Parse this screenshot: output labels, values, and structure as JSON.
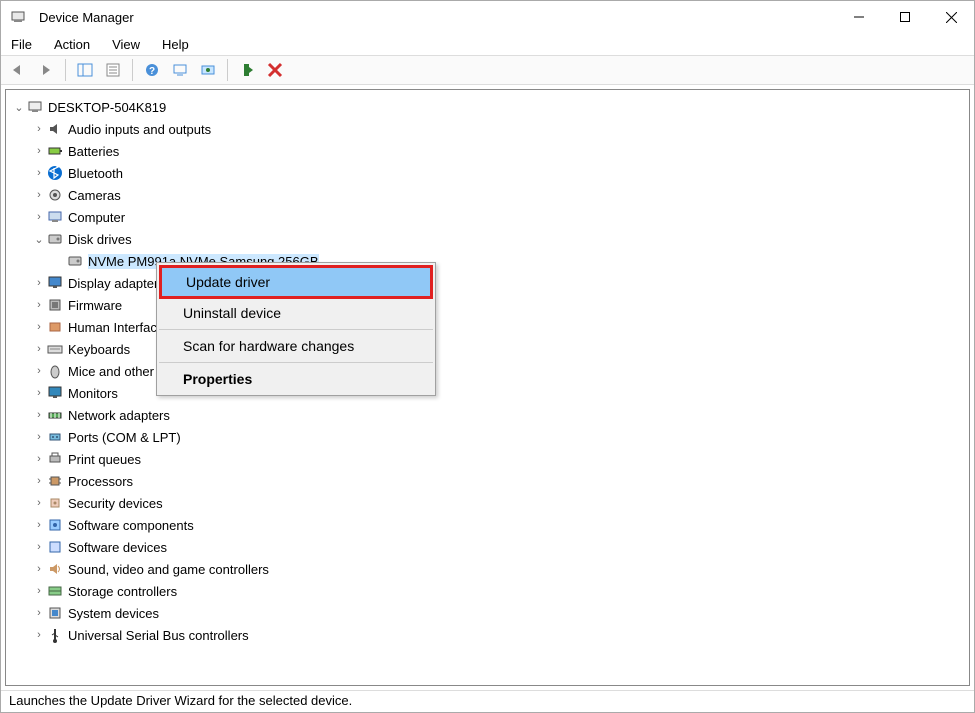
{
  "window": {
    "title": "Device Manager"
  },
  "menu": {
    "file": "File",
    "action": "Action",
    "view": "View",
    "help": "Help"
  },
  "tree": {
    "root": "DESKTOP-504K819",
    "items": [
      {
        "label": "Audio inputs and outputs",
        "icon": "audio"
      },
      {
        "label": "Batteries",
        "icon": "battery"
      },
      {
        "label": "Bluetooth",
        "icon": "bluetooth"
      },
      {
        "label": "Cameras",
        "icon": "camera"
      },
      {
        "label": "Computer",
        "icon": "computer"
      },
      {
        "label": "Disk drives",
        "icon": "disk",
        "expanded": true,
        "children": [
          {
            "label": "NVMe PM991a NVMe Samsung 256GB",
            "icon": "disk",
            "selected": true
          }
        ]
      },
      {
        "label": "Display adapters",
        "icon": "display"
      },
      {
        "label": "Firmware",
        "icon": "firmware"
      },
      {
        "label": "Human Interface Devices",
        "icon": "hid"
      },
      {
        "label": "Keyboards",
        "icon": "keyboard"
      },
      {
        "label": "Mice and other pointing devices",
        "icon": "mouse"
      },
      {
        "label": "Monitors",
        "icon": "monitor"
      },
      {
        "label": "Network adapters",
        "icon": "network"
      },
      {
        "label": "Ports (COM & LPT)",
        "icon": "ports"
      },
      {
        "label": "Print queues",
        "icon": "printer"
      },
      {
        "label": "Processors",
        "icon": "cpu"
      },
      {
        "label": "Security devices",
        "icon": "security"
      },
      {
        "label": "Software components",
        "icon": "swcomp"
      },
      {
        "label": "Software devices",
        "icon": "swdev"
      },
      {
        "label": "Sound, video and game controllers",
        "icon": "sound"
      },
      {
        "label": "Storage controllers",
        "icon": "storage"
      },
      {
        "label": "System devices",
        "icon": "system"
      },
      {
        "label": "Universal Serial Bus controllers",
        "icon": "usb"
      }
    ]
  },
  "context_menu": {
    "update": "Update driver",
    "uninstall": "Uninstall device",
    "scan": "Scan for hardware changes",
    "properties": "Properties"
  },
  "status": "Launches the Update Driver Wizard for the selected device."
}
